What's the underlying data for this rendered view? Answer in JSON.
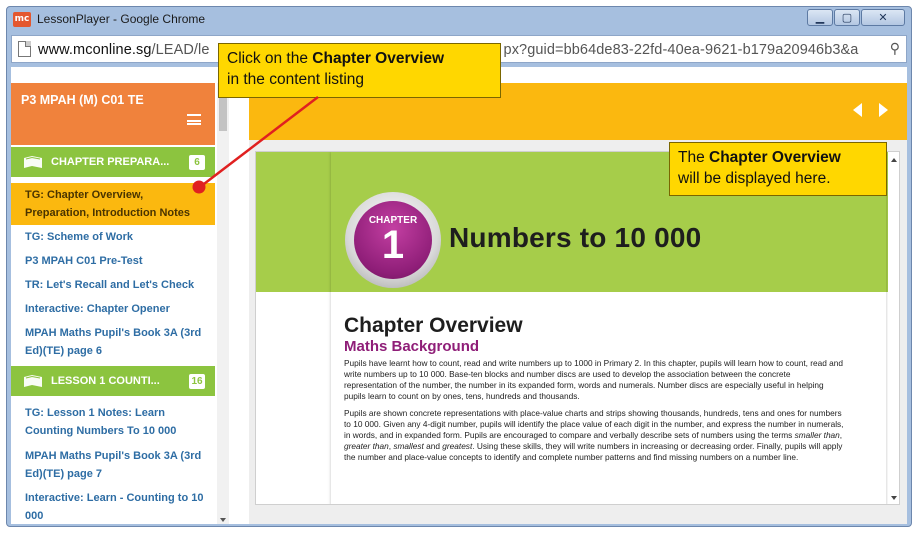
{
  "window": {
    "app_icon": "mc",
    "title": "LessonPlayer - Google Chrome",
    "controls": [
      "minimize",
      "maximize",
      "close"
    ],
    "control_glyphs": [
      "▁",
      "▢",
      "✕"
    ]
  },
  "address_bar": {
    "host": "www.mconline.sg",
    "path_start": "/LEAD/le",
    "path_end": "px?guid=bb64de83-22fd-40ea-9621-b179a20946b3&a",
    "zoom_icon": "magnifier-icon"
  },
  "sidebar": {
    "course_title": "P3 MPAH (M) C01 TE",
    "sections": [
      {
        "label": "CHAPTER PREPARA...",
        "count": "6",
        "items": [
          {
            "label": "TG: Chapter Overview, Preparation, Introduction Notes",
            "active": true
          },
          {
            "label": "TG: Scheme of Work",
            "active": false
          },
          {
            "label": "P3 MPAH C01 Pre-Test",
            "active": false
          },
          {
            "label": "TR: Let's Recall and Let's Check",
            "active": false
          },
          {
            "label": "Interactive: Chapter Opener",
            "active": false
          },
          {
            "label": "MPAH Maths Pupil's Book 3A (3rd Ed)(TE) page 6",
            "active": false
          }
        ]
      },
      {
        "label": "LESSON 1 COUNTI...",
        "count": "16",
        "items": [
          {
            "label": "TG: Lesson 1 Notes: Learn Counting Numbers To 10 000",
            "active": false
          },
          {
            "label": "MPAH Maths Pupil's Book 3A (3rd Ed)(TE) page 7",
            "active": false
          },
          {
            "label": "Interactive: Learn - Counting to 10 000",
            "active": false
          }
        ]
      }
    ]
  },
  "document": {
    "chapter_word": "CHAPTER",
    "chapter_number": "1",
    "chapter_title": "Numbers to 10 000",
    "overview_title": "Chapter Overview",
    "overview_subtitle": "Maths Background",
    "paragraph_1": "Pupils have learnt how to count, read and write numbers up to 1000 in Primary 2. In this chapter, pupils will learn how to count, read and write numbers up to 10 000. Base-ten blocks and number discs are used to develop the association between the concrete representation of the number, the number in its expanded form, words and numerals. Number discs are especially useful in helping pupils learn to count on by ones, tens, hundreds and thousands.",
    "paragraph_2a": "Pupils are shown concrete representations with place-value charts and strips showing thousands, hundreds, tens and ones for numbers to 10 000. Given any 4-digit number, pupils will identify the place value of each digit in the number, and express the number in numerals, in words, and in expanded form. Pupils are encouraged to compare and verbally describe sets of numbers using the terms ",
    "term_smaller": "smaller than",
    "term_greater": "greater than",
    "term_smallest": "smallest",
    "word_and": "and",
    "term_greatest": "greatest",
    "paragraph_2b": ". Using these skills, they will write numbers in increasing or decreasing order. Finally, pupils will apply the number and place-value concepts to identify and complete number patterns and find missing numbers on a number line."
  },
  "callouts": {
    "first": {
      "prefix": "Click on the ",
      "bold": "Chapter Overview",
      "suffix": "in the content listing"
    },
    "second": {
      "prefix": "The ",
      "bold": "Chapter Overview",
      "suffix": "will be displayed here."
    }
  },
  "colors": {
    "accent_orange": "#f0823c",
    "section_green": "#8cc43f",
    "highlight_yellow": "#fbb80f",
    "link_blue": "#2e6da4",
    "chapter_purple": "#8f1e78",
    "callout_yellow": "#ffd700",
    "pointer_red": "#e02020"
  },
  "icons": [
    "mc-app-icon",
    "page-icon",
    "magnifier-icon",
    "hamburger-menu-icon",
    "book-icon",
    "prev-arrow-icon",
    "next-arrow-icon"
  ]
}
